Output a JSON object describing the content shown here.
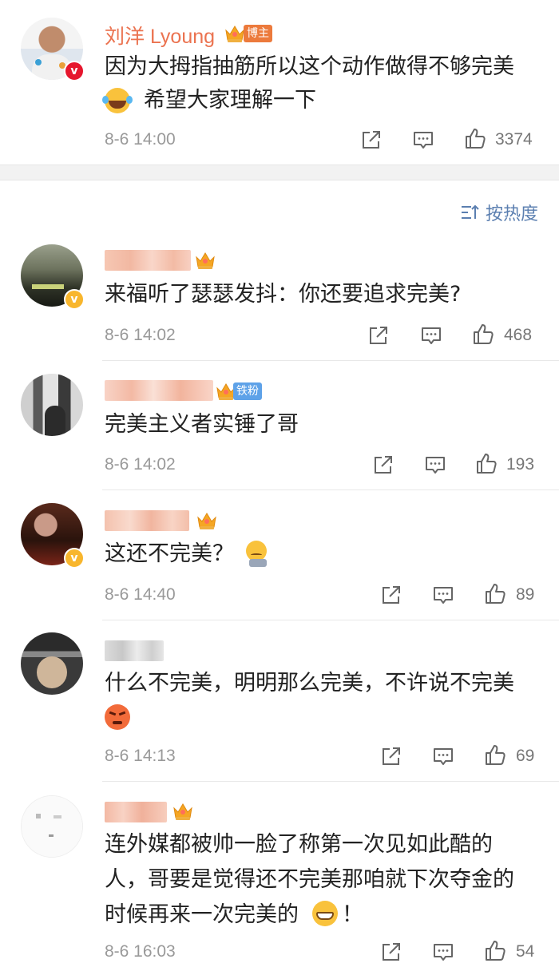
{
  "post": {
    "author": "刘洋 Lyoung",
    "badge": "博主",
    "text_line1": "因为大拇指抽筋所以这个动作做得不够完美",
    "text_line2": "希望大家理解一下",
    "time": "8-6 14:00",
    "likes": "3374"
  },
  "sort": {
    "label": "按热度"
  },
  "comments": [
    {
      "text": "来福听了瑟瑟发抖：你还要追求完美?",
      "time": "8-6 14:02",
      "likes": "468"
    },
    {
      "badge": "铁粉",
      "text": "完美主义者实锤了哥",
      "time": "8-6 14:02",
      "likes": "193"
    },
    {
      "text": "这还不完美？",
      "time": "8-6 14:40",
      "likes": "89"
    },
    {
      "text_line1": "什么不完美，明明那么完美，不许说不完美",
      "time": "8-6 14:13",
      "likes": "69"
    },
    {
      "text_line1": "连外媒都被帅一脸了称第一次见如此酷的",
      "text_line2": "人，哥要是觉得还不完美那咱就下次夺金的",
      "text_line3": "时候再来一次完美的",
      "text_tail": "！",
      "time": "8-6 16:03",
      "likes": "54"
    }
  ],
  "colors": {
    "name": "#eb7350",
    "link": "#5b7fb0",
    "meta": "#999999",
    "verified_red": "#e6162d",
    "verified_gold": "#f8b62d"
  }
}
